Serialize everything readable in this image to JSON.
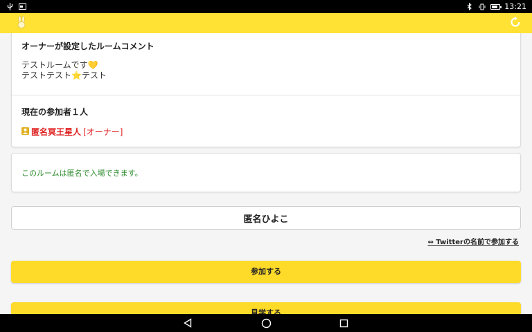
{
  "status_bar": {
    "time": "13:21",
    "battery_level": 0.75
  },
  "app_bar": {
    "logo_icon": "rabbit-icon",
    "refresh_icon": "refresh-icon",
    "accent_color": "#ffe234"
  },
  "room": {
    "comment_title": "オーナーが設定したルームコメント",
    "comment_line1": "テストルームです💛",
    "comment_line2": "テストテスト⭐テスト",
    "participants_title": "現在の参加者１人",
    "participants": [
      {
        "name": "匿名冥王星人",
        "role": "[オーナー]"
      }
    ]
  },
  "notice": {
    "text": "このルームは匿名で入場できます。",
    "color": "#2e8b2e"
  },
  "join_form": {
    "name_value": "匿名ひよこ",
    "twitter_link": "⇔ Twitterの名前で参加する",
    "join_label": "参加する",
    "watch_label": "見学する",
    "button_color": "#ffdb29"
  }
}
